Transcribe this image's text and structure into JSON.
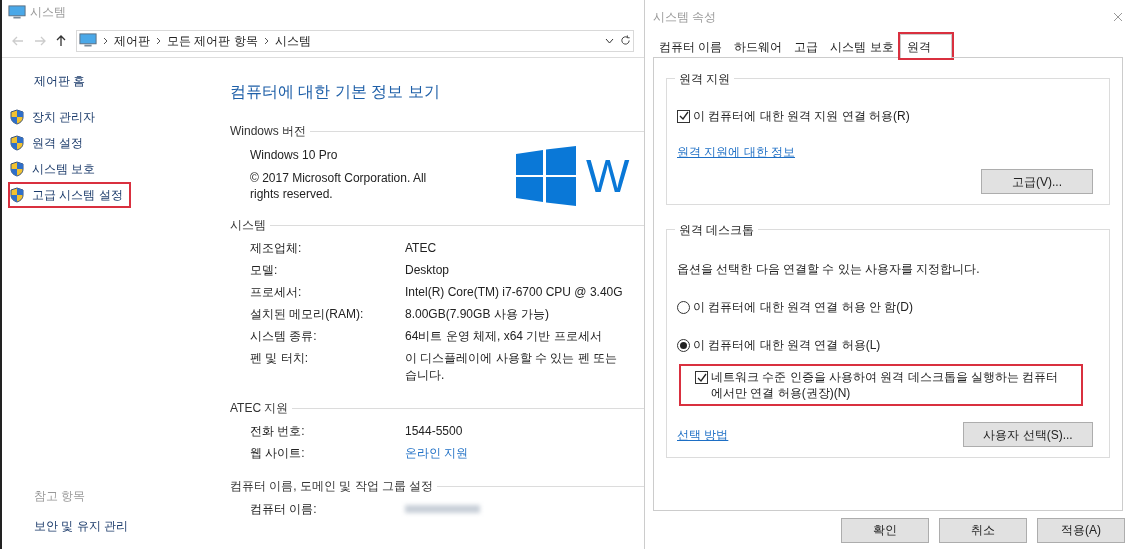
{
  "system_window": {
    "title": "시스템",
    "breadcrumb": [
      "제어판",
      "모든 제어판 항목",
      "시스템"
    ],
    "sidebar": {
      "home": "제어판 홈",
      "links": [
        {
          "label": "장치 관리자",
          "highlighted": false
        },
        {
          "label": "원격 설정",
          "highlighted": false
        },
        {
          "label": "시스템 보호",
          "highlighted": false
        },
        {
          "label": "고급 시스템 설정",
          "highlighted": true
        }
      ],
      "see_also_title": "참고 항목",
      "see_also": [
        "보안 및 유지 관리"
      ]
    },
    "heading": "컴퓨터에 대한 기본 정보 보기",
    "windows_edition": {
      "title": "Windows 버전",
      "edition": "Windows 10 Pro",
      "copyright": "© 2017 Microsoft Corporation. All rights reserved.",
      "logo_text": "W"
    },
    "sections": [
      {
        "title": "시스템",
        "rows": [
          {
            "label": "제조업체:",
            "value": "ATEC"
          },
          {
            "label": "모델:",
            "value": "Desktop"
          },
          {
            "label": "프로세서:",
            "value": "Intel(R) Core(TM) i7-6700 CPU @ 3.40G"
          },
          {
            "label": "설치된 메모리(RAM):",
            "value": "8.00GB(7.90GB 사용 가능)"
          },
          {
            "label": "시스템 종류:",
            "value": "64비트 운영 체제, x64 기반 프로세서"
          },
          {
            "label": "펜 및 터치:",
            "value": "이 디스플레이에 사용할 수 있는 펜 또는\n습니다."
          }
        ]
      },
      {
        "title": "ATEC 지원",
        "rows": [
          {
            "label": "전화 번호:",
            "value": "1544-5500"
          },
          {
            "label": "웹 사이트:",
            "value": "온라인 지원",
            "kind": "link"
          }
        ]
      },
      {
        "title": "컴퓨터 이름, 도메인 및 작업 그룹 설정",
        "rows": [
          {
            "label": "컴퓨터 이름:",
            "kind": "blurred"
          }
        ]
      }
    ]
  },
  "properties_dialog": {
    "title": "시스템 속성",
    "tabs": [
      {
        "label": "컴퓨터 이름",
        "selected": false,
        "highlighted": false
      },
      {
        "label": "하드웨어",
        "selected": false,
        "highlighted": false
      },
      {
        "label": "고급",
        "selected": false,
        "highlighted": false
      },
      {
        "label": "시스템 보호",
        "selected": false,
        "highlighted": false
      },
      {
        "label": "원격",
        "selected": true,
        "highlighted": true
      }
    ],
    "remote_assistance": {
      "title": "원격 지원",
      "allow": {
        "label": "이 컴퓨터에 대한 원격 지원 연결 허용(R)",
        "checked": true
      },
      "info_link": "원격 지원에 대한 정보",
      "advanced_button": "고급(V)..."
    },
    "remote_desktop": {
      "title": "원격 데스크톱",
      "description": "옵션을 선택한 다음 연결할 수 있는 사용자를 지정합니다.",
      "options": [
        {
          "label": "이 컴퓨터에 대한 원격 연결 허용 안 함(D)",
          "selected": false
        },
        {
          "label": "이 컴퓨터에 대한 원격 연결 허용(L)",
          "selected": true
        }
      ],
      "nla": {
        "label": "네트워크 수준 인증을 사용하여 원격 데스크톱을 실행하는 컴퓨터\n에서만 연결 허용(권장)(N)",
        "checked": true,
        "highlighted": true
      },
      "help_link": "선택 방법",
      "select_users_button": "사용자 선택(S)..."
    },
    "buttons": [
      "확인",
      "취소",
      "적용(A)"
    ]
  }
}
